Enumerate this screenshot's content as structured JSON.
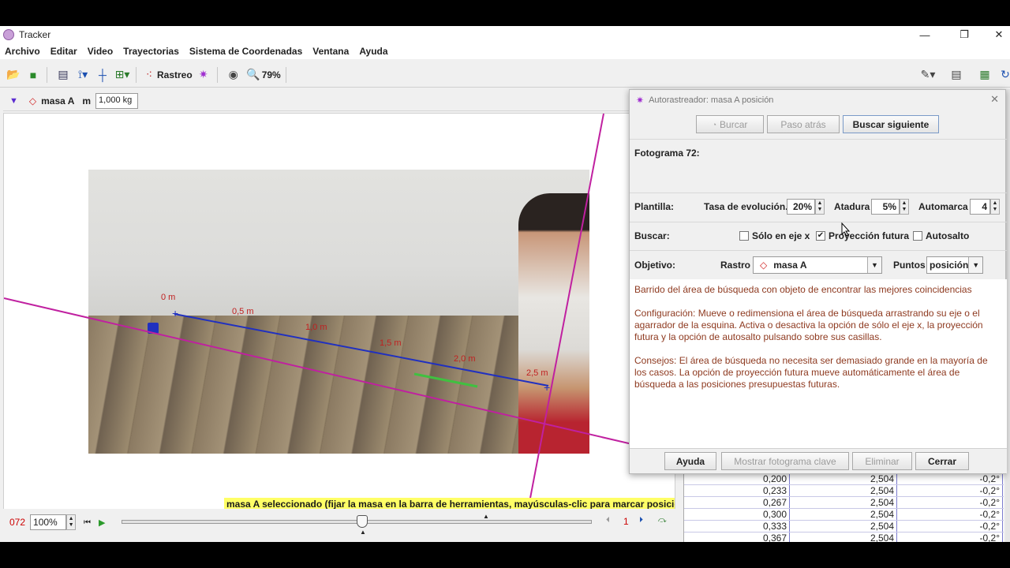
{
  "window": {
    "title": "Tracker"
  },
  "menu": [
    "Archivo",
    "Editar",
    "Video",
    "Trayectorias",
    "Sistema de Coordenadas",
    "Ventana",
    "Ayuda"
  ],
  "toolbar": {
    "track_label": "Rastreo",
    "zoom_label": "79%"
  },
  "track": {
    "name": "masa A",
    "mass_label": "m",
    "mass_value": "1,000 kg"
  },
  "video_labels": {
    "m0": "0 m",
    "m05": "0,5 m",
    "m10": "1,0 m",
    "m15": "1,5 m",
    "m20": "2,0 m",
    "m25": "2,5 m"
  },
  "status": "masa A seleccionado (fijar la masa en la barra de herramientas, mayúsculas-clic para marcar posiciones)",
  "player": {
    "frame": "072",
    "zoom": "100%",
    "step": "1"
  },
  "dialog": {
    "title": "Autorastreador: masa A posición",
    "btn_search": "Burcar",
    "btn_back": "Paso atrás",
    "btn_next": "Buscar siguiente",
    "frame_label": "Fotograma 72:",
    "template_label": "Plantilla:",
    "evolution_label": "Tasa de evolución.",
    "evolution_value": "20%",
    "tether_label": "Atadura",
    "tether_value": "5%",
    "automark_label": "Automarca",
    "automark_value": "4",
    "search_label": "Buscar:",
    "xaxis_label": "Sólo en eje x",
    "future_label": "Proyección futura",
    "autoskip_label": "Autosalto",
    "target_label": "Objetivo:",
    "track_label": "Rastro",
    "track_value": "masa A",
    "points_label": "Puntos",
    "points_value": "posición",
    "help_p1": "Barrido del área de búsqueda con objeto de encontrar las mejores coincidencias",
    "help_p2": "Configuración: Mueve o redimensiona el área de búsqueda arrastrando su eje o el agarrador de la esquina. Activa o desactiva la opción de sólo el eje x, la proyección futura y la opción de autosalto pulsando sobre sus casillas.",
    "help_p3": "Consejos: El área de búsqueda no necesita ser demasiado grande en la mayoría de los casos. La opción de proyección futura mueve automáticamente el área de búsqueda a las posiciones presupuestas futuras.",
    "btn_help": "Ayuda",
    "btn_keyframe": "Mostrar fotograma clave",
    "btn_delete": "Eliminar",
    "btn_close": "Cerrar",
    "future_checked": true
  },
  "table": [
    [
      "0,200",
      "2,504",
      "-0,2°"
    ],
    [
      "0,233",
      "2,504",
      "-0,2°"
    ],
    [
      "0,267",
      "2,504",
      "-0,2°"
    ],
    [
      "0,300",
      "2,504",
      "-0,2°"
    ],
    [
      "0,333",
      "2,504",
      "-0,2°"
    ],
    [
      "0,367",
      "2,504",
      "-0,2°"
    ]
  ]
}
